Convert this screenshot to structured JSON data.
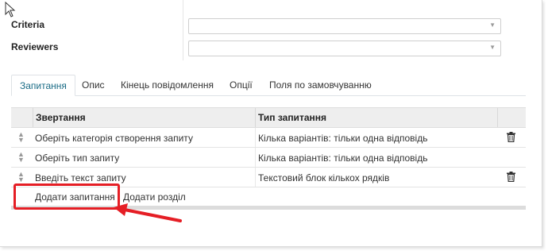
{
  "form": {
    "criteria_label": "Criteria",
    "reviewers_label": "Reviewers",
    "criteria_value": "",
    "reviewers_value": ""
  },
  "tabs": [
    {
      "label": "Запитання",
      "active": true
    },
    {
      "label": "Опис",
      "active": false
    },
    {
      "label": "Кінець повідомлення",
      "active": false
    },
    {
      "label": "Опції",
      "active": false
    },
    {
      "label": "Поля по замовчуванню",
      "active": false
    }
  ],
  "grid": {
    "headers": [
      "Звертання",
      "Тип запитання"
    ],
    "rows": [
      {
        "prompt": "Оберіть категорія створення запиту",
        "type": "Кілька варіантів: тільки одна відповідь"
      },
      {
        "prompt": "Оберіть тип запиту",
        "type": "Кілька варіантів: тільки одна відповідь"
      },
      {
        "prompt": "Введіть текст запиту",
        "type": "Текстовий блок кількох рядків"
      }
    ],
    "add_question": "Додати запитання",
    "add_section": "Додати розділ"
  },
  "annotation": {
    "highlight_color": "#e51e25"
  },
  "icons": {
    "drag_handle": "drag-handle-icon",
    "delete": "trash-icon",
    "dropdown": "chevron-down-icon"
  }
}
